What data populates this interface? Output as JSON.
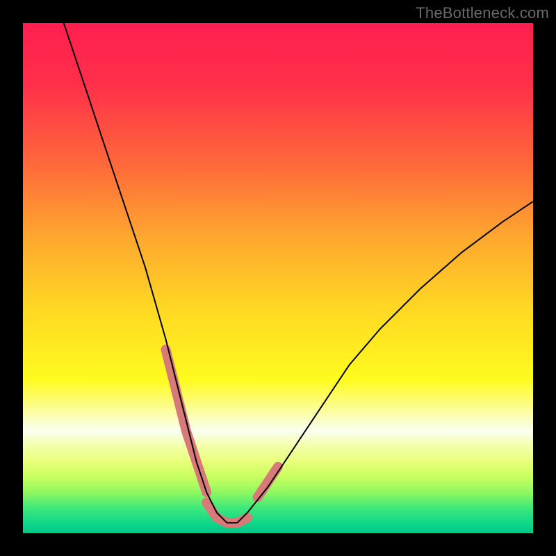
{
  "watermark": "TheBottleneck.com",
  "chart_data": {
    "type": "line",
    "title": "",
    "xlabel": "",
    "ylabel": "",
    "xlim": [
      0,
      100
    ],
    "ylim": [
      0,
      100
    ],
    "grid": false,
    "legend": false,
    "series": [
      {
        "name": "bottleneck-curve",
        "x": [
          8,
          12,
          16,
          20,
          24,
          28,
          30,
          32,
          34,
          36,
          38,
          40,
          42,
          44,
          48,
          52,
          56,
          60,
          64,
          70,
          78,
          86,
          94,
          100
        ],
        "y": [
          100,
          88,
          76,
          64,
          52,
          38,
          30,
          22,
          14,
          8,
          4,
          2,
          2,
          4,
          9,
          15,
          21,
          27,
          33,
          40,
          48,
          55,
          61,
          65
        ],
        "stroke": "#000000",
        "stroke_width": 2
      }
    ],
    "highlight_segments": [
      {
        "name": "left-descent-highlight",
        "x": [
          28,
          30,
          32,
          34,
          36
        ],
        "y": [
          36,
          28,
          20,
          14,
          8
        ],
        "stroke": "#d97a7a",
        "stroke_width": 14
      },
      {
        "name": "valley-floor-highlight",
        "x": [
          36,
          38,
          40,
          42,
          44
        ],
        "y": [
          6,
          3,
          2,
          2,
          3
        ],
        "stroke": "#d97a7a",
        "stroke_width": 14
      },
      {
        "name": "right-ascent-highlight",
        "x": [
          46,
          48,
          50
        ],
        "y": [
          7,
          10,
          13
        ],
        "stroke": "#d97a7a",
        "stroke_width": 14
      }
    ],
    "gradient_stops": [
      {
        "offset": 0.0,
        "color": "#ff1f4f"
      },
      {
        "offset": 0.12,
        "color": "#ff2f4a"
      },
      {
        "offset": 0.28,
        "color": "#ff6a3a"
      },
      {
        "offset": 0.42,
        "color": "#ffa72f"
      },
      {
        "offset": 0.56,
        "color": "#ffd823"
      },
      {
        "offset": 0.7,
        "color": "#fffb20"
      },
      {
        "offset": 0.8,
        "color": "#fafff0"
      },
      {
        "offset": 0.83,
        "color": "#f4ffa8"
      },
      {
        "offset": 0.86,
        "color": "#e8ff7a"
      },
      {
        "offset": 0.89,
        "color": "#c8ff60"
      },
      {
        "offset": 0.92,
        "color": "#90f860"
      },
      {
        "offset": 0.95,
        "color": "#40e87a"
      },
      {
        "offset": 0.98,
        "color": "#10d888"
      },
      {
        "offset": 1.0,
        "color": "#00c88a"
      }
    ]
  }
}
